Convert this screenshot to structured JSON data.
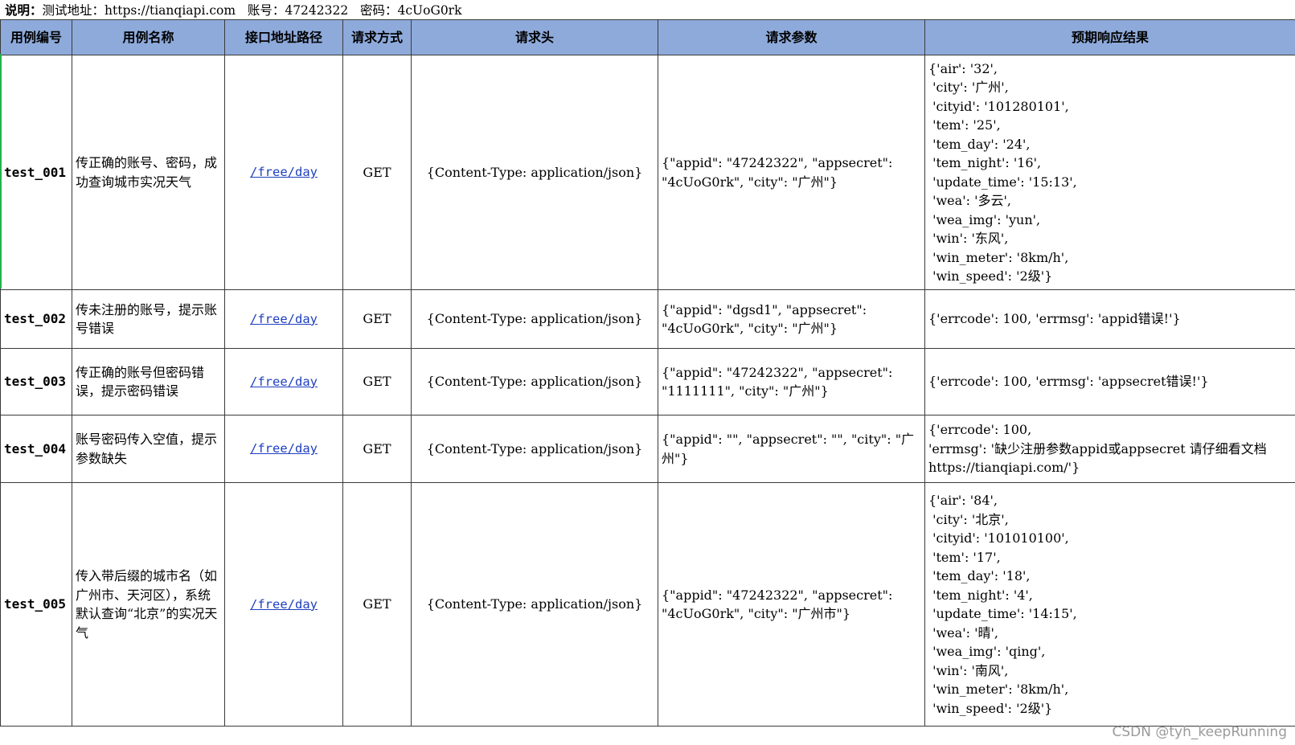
{
  "note": {
    "label": "说明：",
    "text": "测试地址：https://tianqiapi.com   账号：47242322   密码：4cUoG0rk"
  },
  "headers": [
    "用例编号",
    "用例名称",
    "接口地址路径",
    "请求方式",
    "请求头",
    "请求参数",
    "预期响应结果"
  ],
  "rows": [
    {
      "id": "test_001",
      "name": "传正确的账号、密码，成功查询城市实况天气",
      "path": "/free/day",
      "method": "GET",
      "header": "{Content-Type: application/json}",
      "params": "{\"appid\": \"47242322\", \"appsecret\": \"4cUoG0rk\", \"city\": \"广州\"}",
      "response": [
        "{'air': '32',",
        " 'city': '广州',",
        " 'cityid': '101280101',",
        " 'tem': '25',",
        " 'tem_day': '24',",
        " 'tem_night': '16',",
        " 'update_time': '15:13',",
        " 'wea': '多云',",
        " 'wea_img': 'yun',",
        " 'win': '东风',",
        " 'win_meter': '8km/h',",
        " 'win_speed': '2级'}"
      ]
    },
    {
      "id": "test_002",
      "name": "传未注册的账号，提示账号错误",
      "path": "/free/day",
      "method": "GET",
      "header": "{Content-Type: application/json}",
      "params": "{\"appid\": \"dgsd1\", \"appsecret\": \"4cUoG0rk\", \"city\": \"广州\"}",
      "response": [
        "{'errcode': 100, 'errmsg': 'appid错误!'}"
      ]
    },
    {
      "id": "test_003",
      "name": "传正确的账号但密码错误，提示密码错误",
      "path": "/free/day",
      "method": "GET",
      "header": "{Content-Type: application/json}",
      "params": "{\"appid\": \"47242322\", \"appsecret\": \"1111111\", \"city\": \"广州\"}",
      "response": [
        "{'errcode': 100, 'errmsg': 'appsecret错误!'}"
      ]
    },
    {
      "id": "test_004",
      "name": "账号密码传入空值，提示参数缺失",
      "path": "/free/day",
      "method": "GET",
      "header": "{Content-Type: application/json}",
      "params": "{\"appid\": \"\", \"appsecret\": \"\", \"city\": \"广州\"}",
      "response": [
        "{'errcode': 100,",
        " 'errmsg': '缺少注册参数appid或appsecret 请仔细看文档 https://tianqiapi.com/'}"
      ]
    },
    {
      "id": "test_005",
      "name": "传入带后缀的城市名（如广州市、天河区），系统默认查询“北京”的实况天气",
      "path": "/free/day",
      "method": "GET",
      "header": "{Content-Type: application/json}",
      "params": "{\"appid\": \"47242322\", \"appsecret\": \"4cUoG0rk\", \"city\": \"广州市\"}",
      "response": [
        "{'air': '84',",
        " 'city': '北京',",
        " 'cityid': '101010100',",
        " 'tem': '17',",
        " 'tem_day': '18',",
        " 'tem_night': '4',",
        " 'update_time': '14:15',",
        " 'wea': '晴',",
        " 'wea_img': 'qing',",
        " 'win': '南风',",
        " 'win_meter': '8km/h',",
        " 'win_speed': '2级'}"
      ]
    }
  ],
  "watermark": "CSDN @tyh_keepRunning"
}
